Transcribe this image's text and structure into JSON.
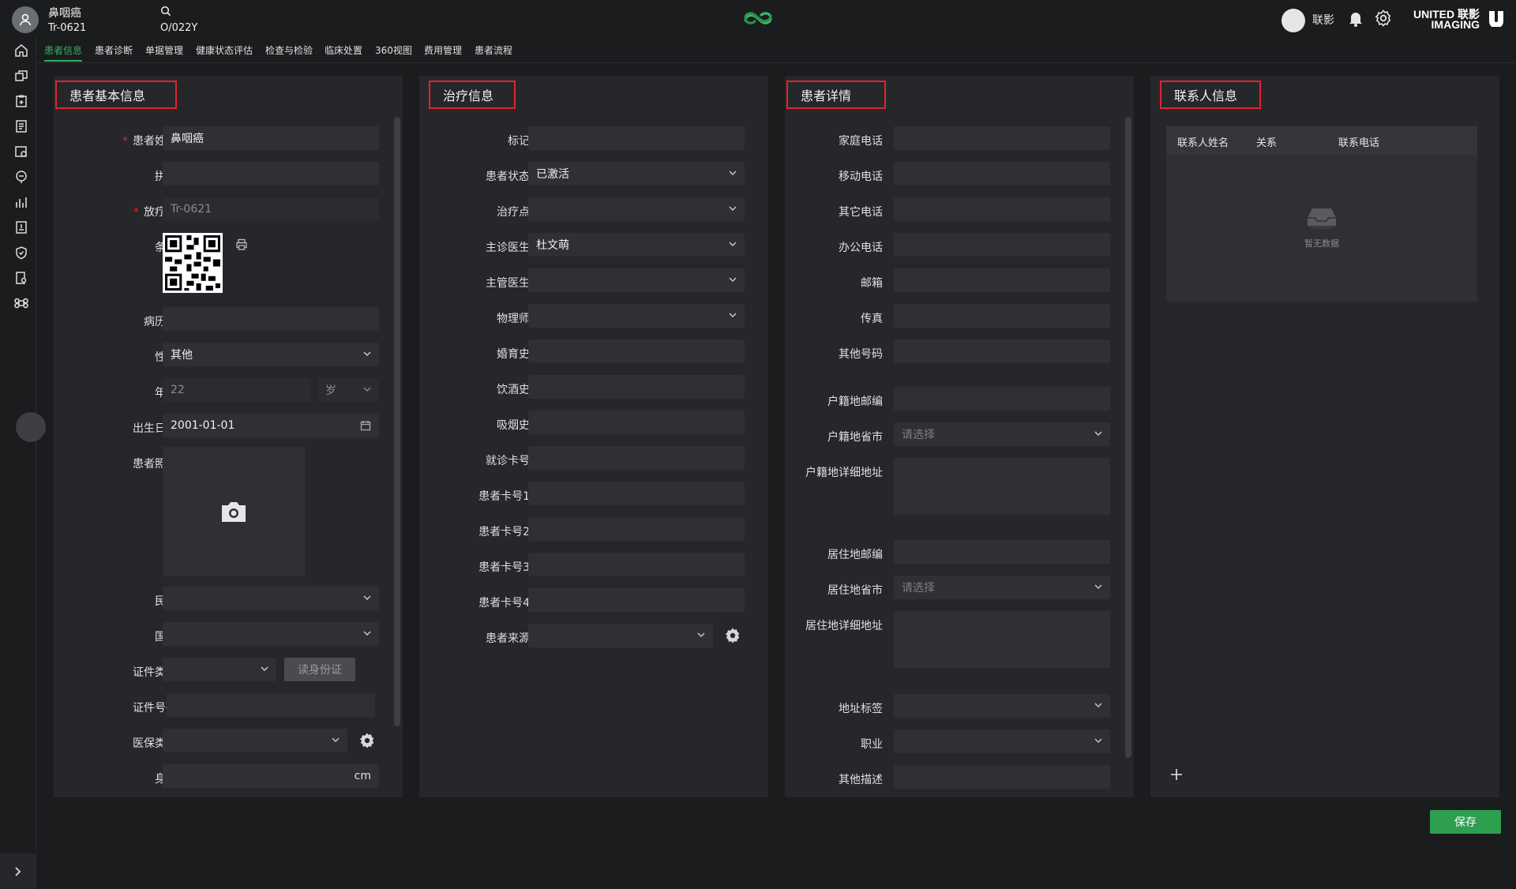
{
  "header": {
    "patient_name": "鼻咽癌",
    "patient_id": "Tr-0621",
    "search_code": "O/022Y",
    "user_name": "联影",
    "brand_line1": "UNITED 联影",
    "brand_line2": "IMAGING"
  },
  "tabs": [
    "患者信息",
    "患者诊断",
    "单据管理",
    "健康状态评估",
    "检查与检验",
    "临床处置",
    "360视图",
    "费用管理",
    "患者流程"
  ],
  "basic": {
    "title": "患者基本信息",
    "name_label": "患者姓名",
    "name_value": "鼻咽癌",
    "pinyin_label": "拼音",
    "pinyin_value": "",
    "rt_label": "放疗号",
    "rt_value": "Tr-0621",
    "barcode_label": "条码",
    "record_label": "病历号",
    "record_value": "",
    "gender_label": "性别",
    "gender_value": "其他",
    "age_label": "年龄",
    "age_value": "22",
    "age_unit": "岁",
    "dob_label": "出生日期",
    "dob_value": "2001-01-01",
    "photo_label": "患者照片",
    "ethnic_label": "民族",
    "nationality_label": "国籍",
    "id_type_label": "证件类别",
    "read_id_button": "读身份证",
    "id_number_label": "证件号码",
    "insurance_label": "医保类型",
    "height_label": "身高",
    "height_unit": "cm"
  },
  "treatment": {
    "title": "治疗信息",
    "mark_label": "标记",
    "status_label": "患者状态",
    "status_value": "已激活",
    "point_label": "治疗点",
    "attending_label": "主诊医生",
    "attending_value": "杜文萌",
    "managing_label": "主管医生",
    "physicist_label": "物理师",
    "marital_label": "婚育史",
    "drinking_label": "饮酒史",
    "smoking_label": "吸烟史",
    "visit_card_label": "就诊卡号",
    "card1_label": "患者卡号1",
    "card2_label": "患者卡号2",
    "card3_label": "患者卡号3",
    "card4_label": "患者卡号4",
    "source_label": "患者来源"
  },
  "details": {
    "title": "患者详情",
    "home_phone": "家庭电话",
    "mobile": "移动电话",
    "other_phone": "其它电话",
    "office_phone": "办公电话",
    "email": "邮箱",
    "fax": "传真",
    "other_number": "其他号码",
    "hukou_zip": "户籍地邮编",
    "hukou_province": "户籍地省市",
    "hukou_addr": "户籍地详细地址",
    "res_zip": "居住地邮编",
    "res_province": "居住地省市",
    "res_addr": "居住地详细地址",
    "address_tag": "地址标签",
    "occupation": "职业",
    "other_desc": "其他描述",
    "select_placeholder": "请选择"
  },
  "contacts": {
    "title": "联系人信息",
    "col_name": "联系人姓名",
    "col_relation": "关系",
    "col_phone": "联系电话",
    "empty_text": "暂无数据"
  },
  "footer": {
    "save_label": "保存"
  },
  "colors": {
    "accent": "#2fb05a",
    "highlight_border": "#e0242c",
    "panel_bg": "#26272a",
    "page_bg": "#1b1c1e"
  }
}
